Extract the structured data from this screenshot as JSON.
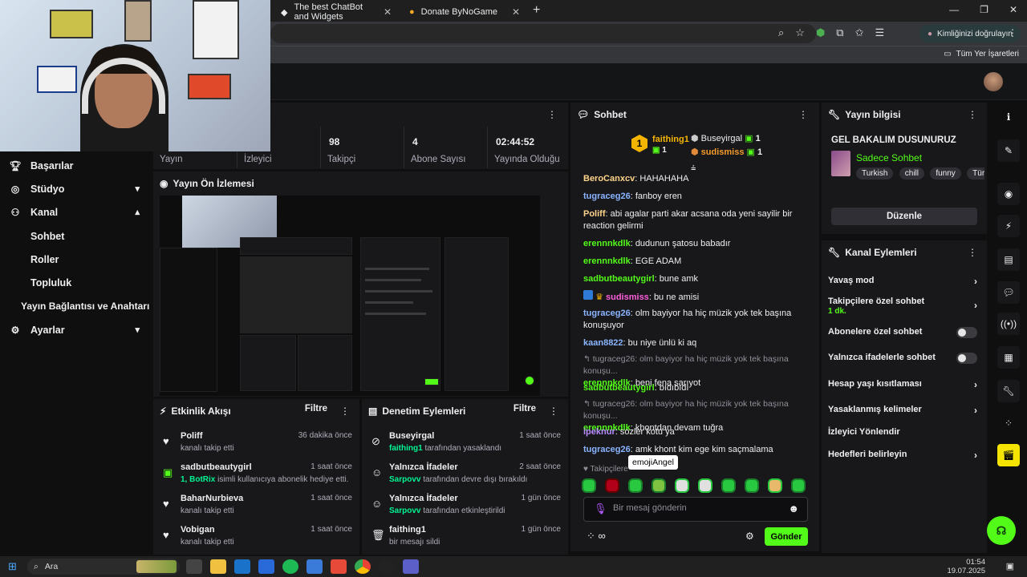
{
  "browser": {
    "tabs": [
      {
        "title": "The best ChatBot and Widgets"
      },
      {
        "title": "Donate ByNoGame"
      }
    ],
    "profile_label": "Kimliğinizi doğrulayın",
    "bookmarks_label": "Tüm Yer İşaretleri"
  },
  "sidebar": {
    "items": [
      {
        "label": "Başarılar",
        "icon": "trophy-icon"
      },
      {
        "label": "Stüdyo",
        "icon": "studio-icon",
        "chevron": "down"
      },
      {
        "label": "Kanal",
        "icon": "channel-icon",
        "chevron": "up"
      },
      {
        "label": "Sohbet"
      },
      {
        "label": "Roller"
      },
      {
        "label": "Topluluk"
      },
      {
        "label": "Yayın Bağlantısı ve Anahtarı"
      },
      {
        "label": "Ayarlar",
        "icon": "gear-icon",
        "chevron": "down"
      }
    ]
  },
  "stats": {
    "items": [
      {
        "num": "",
        "label": "Yayın"
      },
      {
        "num": "",
        "label": "İzleyici"
      },
      {
        "num": "98",
        "label": "Takipçi"
      },
      {
        "num": "4",
        "label": "Abone Sayısı"
      },
      {
        "num": "02:44:52",
        "label": "Yayında Olduğu"
      }
    ]
  },
  "preview": {
    "title": "Yayın Ön İzlemesi"
  },
  "activity": {
    "title": "Etkinlik Akışı",
    "filter": "Filtre",
    "rows": [
      {
        "name": "Poliff",
        "time": "36 dakika önce",
        "desc": "kanalı takip etti",
        "icon": "heart-icon"
      },
      {
        "name": "sadbutbeautygirl",
        "time": "1 saat önce",
        "desc_green": "1, BotRix",
        "desc": " isimli kullanıcıya abonelik hediye etti.",
        "icon": "gift-icon"
      },
      {
        "name": "BaharNurbieva",
        "time": "1 saat önce",
        "desc": "kanalı takip etti",
        "icon": "heart-icon"
      },
      {
        "name": "Vobigan",
        "time": "1 saat önce",
        "desc": "kanalı takip etti",
        "icon": "heart-icon"
      }
    ]
  },
  "moderation": {
    "title": "Denetim Eylemleri",
    "filter": "Filtre",
    "rows": [
      {
        "name": "Buseyirgal",
        "time": "1 saat önce",
        "desc_green": "faithing1",
        "desc": " tarafından yasaklandı",
        "icon": "ban-icon"
      },
      {
        "name": "Yalnızca İfadeler",
        "time": "2 saat önce",
        "desc_green": "Sarpovv",
        "desc": " tarafından devre dışı bırakıldı",
        "icon": "emoji-icon"
      },
      {
        "name": "Yalnızca İfadeler",
        "time": "1 gün önce",
        "desc_green": "Sarpovv",
        "desc": " tarafından etkinleştirildi",
        "icon": "emoji-icon"
      },
      {
        "name": "faithing1",
        "time": "1 gün önce",
        "desc": "bir mesajı sildi",
        "icon": "trash-icon"
      }
    ]
  },
  "chat": {
    "title": "Sohbet",
    "leaders": {
      "first": {
        "rank": "1",
        "name": "faithing1",
        "count": "1"
      },
      "second": {
        "name": "Buseyirgal",
        "count": "1"
      },
      "third": {
        "name": "sudismiss",
        "count": "1"
      }
    },
    "messages": [
      {
        "user": "BeroCanxcv",
        "color": "#ffd48a",
        "text": "HAHAHAHA"
      },
      {
        "user": "tugraceg26",
        "color": "#8ab4ff",
        "text": "fanboy eren"
      },
      {
        "user": "Poliff",
        "color": "#ffd48a",
        "text": "abi agalar parti akar acsana oda yeni sayilir bir reaction gelirmi"
      },
      {
        "user": "erennnkdlk",
        "color": "#53fc18",
        "text": "dudunun şatosu babadır"
      },
      {
        "user": "erennnkdlk",
        "color": "#53fc18",
        "text": "EGE ADAM"
      },
      {
        "user": "sadbutbeautygirl",
        "color": "#53fc18",
        "text": "bune amk"
      },
      {
        "user": "sudismiss",
        "color": "#ff5edc",
        "text": "bu ne amisi"
      },
      {
        "user": "tugraceg26",
        "color": "#8ab4ff",
        "text": "olm bayiyor ha hiç müzik yok tek başına konuşuyor"
      },
      {
        "user": "kaan8822",
        "color": "#8ab4ff",
        "text": "bu niye ünlü ki aq"
      },
      {
        "reply": "tugraceg26: olm bayiyor ha hiç müzik yok tek başına konuşu...",
        "user": "erennnkdlk",
        "color": "#53fc18",
        "text": "beni fena sarıyot"
      },
      {
        "user": "sadbutbeautygirl",
        "color": "#53fc18",
        "text": "bıdıbıdı"
      },
      {
        "reply": "tugraceg26: olm bayiyor ha hiç müzik yok tek başına konuşu...",
        "user": "erennnkdlk",
        "color": "#53fc18",
        "text": "khontdan devam tuğra"
      },
      {
        "user": "ipeknur",
        "color": "#b98cff",
        "text": "sozler kotu ya"
      },
      {
        "user": "tugraceg26",
        "color": "#8ab4ff",
        "text": "amk khont kim ege kim saçmalama"
      }
    ],
    "followers_only_hint": "Takipçilere",
    "tooltip": "emojiAngel",
    "input_placeholder": "Bir mesaj gönderin",
    "send_label": "Gönder"
  },
  "stream_info": {
    "title": "Yayın bilgisi",
    "stream_title": "GEL BAKALIM DUSUNURUZ",
    "category": "Sadece Sohbet",
    "tags": [
      "Turkish",
      "chill",
      "funny",
      "Türk"
    ],
    "edit_label": "Düzenle"
  },
  "channel_actions": {
    "title": "Kanal Eylemleri",
    "items": [
      {
        "label": "Yavaş mod",
        "type": "chevron"
      },
      {
        "label": "Takipçilere özel sohbet",
        "sub": "1 dk.",
        "type": "chevron"
      },
      {
        "label": "Abonelere özel sohbet",
        "type": "toggle",
        "on": false
      },
      {
        "label": "Yalnızca ifadelerle sohbet",
        "type": "toggle",
        "on": false
      },
      {
        "label": "Hesap yaşı kısıtlaması",
        "type": "chevron"
      },
      {
        "label": "Yasaklanmış kelimeler",
        "type": "chevron"
      },
      {
        "label": "İzleyici Yönlendir",
        "type": "none"
      },
      {
        "label": "Hedefleri belirleyin",
        "type": "chevron"
      }
    ]
  },
  "taskbar": {
    "search": "Ara",
    "time": "01:54",
    "date": "19.07.2025"
  },
  "colors": {
    "accent": "#53fc18",
    "panel": "#18181b",
    "bg": "#0f0f0f"
  }
}
